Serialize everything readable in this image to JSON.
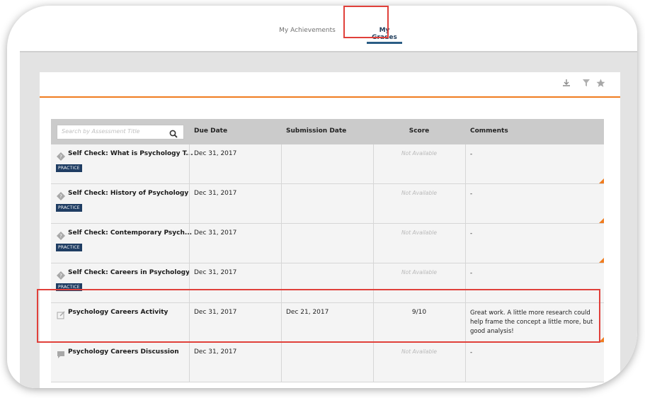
{
  "tabs": [
    {
      "label": "My Achievements",
      "active": false
    },
    {
      "label": "My Grades",
      "active": true
    }
  ],
  "toolbar": {
    "icons": [
      "download-icon",
      "filter-icon",
      "star-icon"
    ]
  },
  "table": {
    "search_placeholder": "Search by Assessment Title",
    "headers": {
      "due_date": "Due Date",
      "submission_date": "Submission Date",
      "score": "Score",
      "comments": "Comments"
    },
    "rows": [
      {
        "title": "Self Check: What is Psychology T...",
        "icon": "self-check-icon",
        "badge": "PRACTICE",
        "due": "Dec 31, 2017",
        "submitted": "",
        "score": "Not Available",
        "comment": "-"
      },
      {
        "title": "Self Check: History of Psychology",
        "icon": "self-check-icon",
        "badge": "PRACTICE",
        "due": "Dec 31, 2017",
        "submitted": "",
        "score": "Not Available",
        "comment": "-"
      },
      {
        "title": "Self Check: Contemporary Psych...",
        "icon": "self-check-icon",
        "badge": "PRACTICE",
        "due": "Dec 31, 2017",
        "submitted": "",
        "score": "Not Available",
        "comment": "-"
      },
      {
        "title": "Self Check: Careers in Psychology",
        "icon": "self-check-icon",
        "badge": "PRACTICE",
        "due": "Dec 31, 2017",
        "submitted": "",
        "score": "Not Available",
        "comment": "-"
      },
      {
        "title": "Psychology Careers Activity",
        "icon": "activity-edit-icon",
        "badge": "",
        "due": "Dec 31, 2017",
        "submitted": "Dec 21, 2017",
        "score": "9/10",
        "comment": "Great work. A little more research could help frame the concept a little more, but good analysis!"
      },
      {
        "title": "Psychology Careers Discussion",
        "icon": "discussion-icon",
        "badge": "",
        "due": "Dec 31, 2017",
        "submitted": "",
        "score": "Not Available",
        "comment": "-"
      }
    ]
  },
  "colors": {
    "accent_orange": "#f07c1f",
    "highlight_red": "#e0403a",
    "badge_navy": "#1f3d63",
    "active_tab_underline": "#2b5d85"
  }
}
